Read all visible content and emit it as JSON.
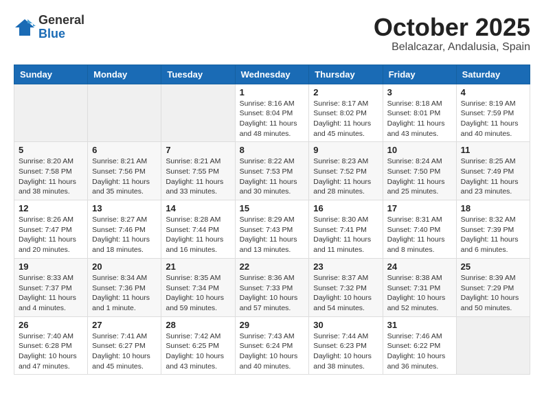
{
  "logo": {
    "general": "General",
    "blue": "Blue"
  },
  "title": {
    "month": "October 2025",
    "location": "Belalcazar, Andalusia, Spain"
  },
  "headers": [
    "Sunday",
    "Monday",
    "Tuesday",
    "Wednesday",
    "Thursday",
    "Friday",
    "Saturday"
  ],
  "weeks": [
    [
      {
        "day": "",
        "info": ""
      },
      {
        "day": "",
        "info": ""
      },
      {
        "day": "",
        "info": ""
      },
      {
        "day": "1",
        "info": "Sunrise: 8:16 AM\nSunset: 8:04 PM\nDaylight: 11 hours and 48 minutes."
      },
      {
        "day": "2",
        "info": "Sunrise: 8:17 AM\nSunset: 8:02 PM\nDaylight: 11 hours and 45 minutes."
      },
      {
        "day": "3",
        "info": "Sunrise: 8:18 AM\nSunset: 8:01 PM\nDaylight: 11 hours and 43 minutes."
      },
      {
        "day": "4",
        "info": "Sunrise: 8:19 AM\nSunset: 7:59 PM\nDaylight: 11 hours and 40 minutes."
      }
    ],
    [
      {
        "day": "5",
        "info": "Sunrise: 8:20 AM\nSunset: 7:58 PM\nDaylight: 11 hours and 38 minutes."
      },
      {
        "day": "6",
        "info": "Sunrise: 8:21 AM\nSunset: 7:56 PM\nDaylight: 11 hours and 35 minutes."
      },
      {
        "day": "7",
        "info": "Sunrise: 8:21 AM\nSunset: 7:55 PM\nDaylight: 11 hours and 33 minutes."
      },
      {
        "day": "8",
        "info": "Sunrise: 8:22 AM\nSunset: 7:53 PM\nDaylight: 11 hours and 30 minutes."
      },
      {
        "day": "9",
        "info": "Sunrise: 8:23 AM\nSunset: 7:52 PM\nDaylight: 11 hours and 28 minutes."
      },
      {
        "day": "10",
        "info": "Sunrise: 8:24 AM\nSunset: 7:50 PM\nDaylight: 11 hours and 25 minutes."
      },
      {
        "day": "11",
        "info": "Sunrise: 8:25 AM\nSunset: 7:49 PM\nDaylight: 11 hours and 23 minutes."
      }
    ],
    [
      {
        "day": "12",
        "info": "Sunrise: 8:26 AM\nSunset: 7:47 PM\nDaylight: 11 hours and 20 minutes."
      },
      {
        "day": "13",
        "info": "Sunrise: 8:27 AM\nSunset: 7:46 PM\nDaylight: 11 hours and 18 minutes."
      },
      {
        "day": "14",
        "info": "Sunrise: 8:28 AM\nSunset: 7:44 PM\nDaylight: 11 hours and 16 minutes."
      },
      {
        "day": "15",
        "info": "Sunrise: 8:29 AM\nSunset: 7:43 PM\nDaylight: 11 hours and 13 minutes."
      },
      {
        "day": "16",
        "info": "Sunrise: 8:30 AM\nSunset: 7:41 PM\nDaylight: 11 hours and 11 minutes."
      },
      {
        "day": "17",
        "info": "Sunrise: 8:31 AM\nSunset: 7:40 PM\nDaylight: 11 hours and 8 minutes."
      },
      {
        "day": "18",
        "info": "Sunrise: 8:32 AM\nSunset: 7:39 PM\nDaylight: 11 hours and 6 minutes."
      }
    ],
    [
      {
        "day": "19",
        "info": "Sunrise: 8:33 AM\nSunset: 7:37 PM\nDaylight: 11 hours and 4 minutes."
      },
      {
        "day": "20",
        "info": "Sunrise: 8:34 AM\nSunset: 7:36 PM\nDaylight: 11 hours and 1 minute."
      },
      {
        "day": "21",
        "info": "Sunrise: 8:35 AM\nSunset: 7:34 PM\nDaylight: 10 hours and 59 minutes."
      },
      {
        "day": "22",
        "info": "Sunrise: 8:36 AM\nSunset: 7:33 PM\nDaylight: 10 hours and 57 minutes."
      },
      {
        "day": "23",
        "info": "Sunrise: 8:37 AM\nSunset: 7:32 PM\nDaylight: 10 hours and 54 minutes."
      },
      {
        "day": "24",
        "info": "Sunrise: 8:38 AM\nSunset: 7:31 PM\nDaylight: 10 hours and 52 minutes."
      },
      {
        "day": "25",
        "info": "Sunrise: 8:39 AM\nSunset: 7:29 PM\nDaylight: 10 hours and 50 minutes."
      }
    ],
    [
      {
        "day": "26",
        "info": "Sunrise: 7:40 AM\nSunset: 6:28 PM\nDaylight: 10 hours and 47 minutes."
      },
      {
        "day": "27",
        "info": "Sunrise: 7:41 AM\nSunset: 6:27 PM\nDaylight: 10 hours and 45 minutes."
      },
      {
        "day": "28",
        "info": "Sunrise: 7:42 AM\nSunset: 6:25 PM\nDaylight: 10 hours and 43 minutes."
      },
      {
        "day": "29",
        "info": "Sunrise: 7:43 AM\nSunset: 6:24 PM\nDaylight: 10 hours and 40 minutes."
      },
      {
        "day": "30",
        "info": "Sunrise: 7:44 AM\nSunset: 6:23 PM\nDaylight: 10 hours and 38 minutes."
      },
      {
        "day": "31",
        "info": "Sunrise: 7:46 AM\nSunset: 6:22 PM\nDaylight: 10 hours and 36 minutes."
      },
      {
        "day": "",
        "info": ""
      }
    ]
  ]
}
